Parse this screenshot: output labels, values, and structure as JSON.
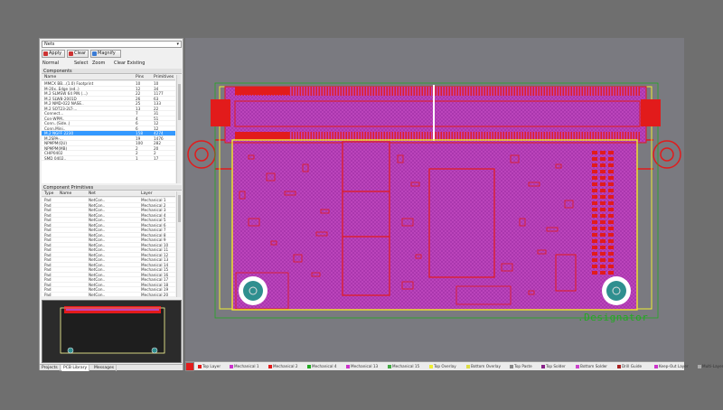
{
  "panel": {
    "combo_value": "Nets",
    "buttons": {
      "apply": "Apply",
      "clear": "Clear",
      "magnify": "Magnify"
    },
    "mode": {
      "normal": "Normal",
      "select": "Select",
      "zoom": "Zoom",
      "clear_existing": "Clear Existing"
    },
    "components_title": "Components",
    "components_headers": [
      "Name",
      "Pins",
      "Primitives"
    ],
    "components": [
      [
        "MMCX BB...(1.0) Footprint",
        "10",
        "10"
      ],
      [
        "M-20x..Edge (ed..)",
        "12",
        "34"
      ],
      [
        "M.2 SLMSW 64 PIN (...)",
        "22",
        "1177"
      ],
      [
        "M.2 SLW8-2001D",
        "26",
        "63"
      ],
      [
        "M.2 NMD-022 NASE..",
        "25",
        "133"
      ],
      [
        "M.2 SOT23-2LT-...",
        "13",
        "22"
      ],
      [
        "Connect...",
        "7",
        "31"
      ],
      [
        "Con-WPM..",
        "4",
        "51"
      ],
      [
        "Conn..(Side..)",
        "6",
        "12"
      ],
      [
        "Conn.Mini..",
        "6",
        "12"
      ],
      [
        "M.2 NGFF 2230",
        "158",
        "4274"
      ],
      [
        "M.2SPA-...",
        "19",
        "1476"
      ],
      [
        "NPMPM(QU)",
        "100",
        "282"
      ],
      [
        "NPMPM(MB)",
        "2",
        "20"
      ],
      [
        "CHIP0402",
        "2",
        "2"
      ],
      [
        "SMD 0402..",
        "1",
        "17"
      ]
    ],
    "primitives_title": "Component Primitives",
    "primitives_headers": [
      "Type",
      "Name",
      "Net",
      "Layer"
    ],
    "primitives": [
      [
        "Pad",
        "",
        "NetCon..",
        "Mechanical 1"
      ],
      [
        "Pad",
        "",
        "NetCon..",
        "Mechanical 2"
      ],
      [
        "Pad",
        "",
        "NetCon..",
        "Mechanical 3"
      ],
      [
        "Pad",
        "",
        "NetCon..",
        "Mechanical 4"
      ],
      [
        "Pad",
        "",
        "NetCon..",
        "Mechanical 5"
      ],
      [
        "Pad",
        "",
        "NetCon..",
        "Mechanical 6"
      ],
      [
        "Pad",
        "",
        "NetCon..",
        "Mechanical 7"
      ],
      [
        "Pad",
        "",
        "NetCon..",
        "Mechanical 8"
      ],
      [
        "Pad",
        "",
        "NetCon..",
        "Mechanical 9"
      ],
      [
        "Pad",
        "",
        "NetCon..",
        "Mechanical 10"
      ],
      [
        "Pad",
        "",
        "NetCon..",
        "Mechanical 11"
      ],
      [
        "Pad",
        "",
        "NetCon..",
        "Mechanical 12"
      ],
      [
        "Pad",
        "",
        "NetCon..",
        "Mechanical 13"
      ],
      [
        "Pad",
        "",
        "NetCon..",
        "Mechanical 14"
      ],
      [
        "Pad",
        "",
        "NetCon..",
        "Mechanical 15"
      ],
      [
        "Pad",
        "",
        "NetCon..",
        "Mechanical 16"
      ],
      [
        "Pad",
        "",
        "NetCon..",
        "Mechanical 17"
      ],
      [
        "Pad",
        "",
        "NetCon..",
        "Mechanical 18"
      ],
      [
        "Pad",
        "",
        "NetCon..",
        "Mechanical 19"
      ],
      [
        "Pad",
        "",
        "NetCon..",
        "Mechanical 20"
      ]
    ],
    "bottom_tabs": [
      "Projects",
      "PCB Library",
      "Messages"
    ]
  },
  "canvas": {
    "designator": ".Designator",
    "colors": {
      "board": "#bb44bb",
      "copper": "#e21b1b",
      "outline": "#eeee33",
      "silk": "#ffffff"
    }
  },
  "layerbar": {
    "current_color": "#e21b1b",
    "tabs": [
      {
        "label": "Top Layer",
        "color": "#e21b1b"
      },
      {
        "label": "Mechanical 1",
        "color": "#cc33cc"
      },
      {
        "label": "Mechanical 2",
        "color": "#e21b1b"
      },
      {
        "label": "Mechanical 4",
        "color": "#22aa22"
      },
      {
        "label": "Mechanical 13",
        "color": "#cc33cc"
      },
      {
        "label": "Mechanical 15",
        "color": "#44aa44"
      },
      {
        "label": "Top Overlay",
        "color": "#eeee33"
      },
      {
        "label": "Bottom Overlay",
        "color": "#dddd44"
      },
      {
        "label": "Top Paste",
        "color": "#888888"
      },
      {
        "label": "Top Solder",
        "color": "#882288"
      },
      {
        "label": "Bottom Solder",
        "color": "#cc44cc"
      },
      {
        "label": "Drill Guide",
        "color": "#aa2222"
      },
      {
        "label": "Keep-Out Layer",
        "color": "#cc33cc"
      },
      {
        "label": "Multi-Layer",
        "color": "#aaaaaa"
      }
    ]
  }
}
